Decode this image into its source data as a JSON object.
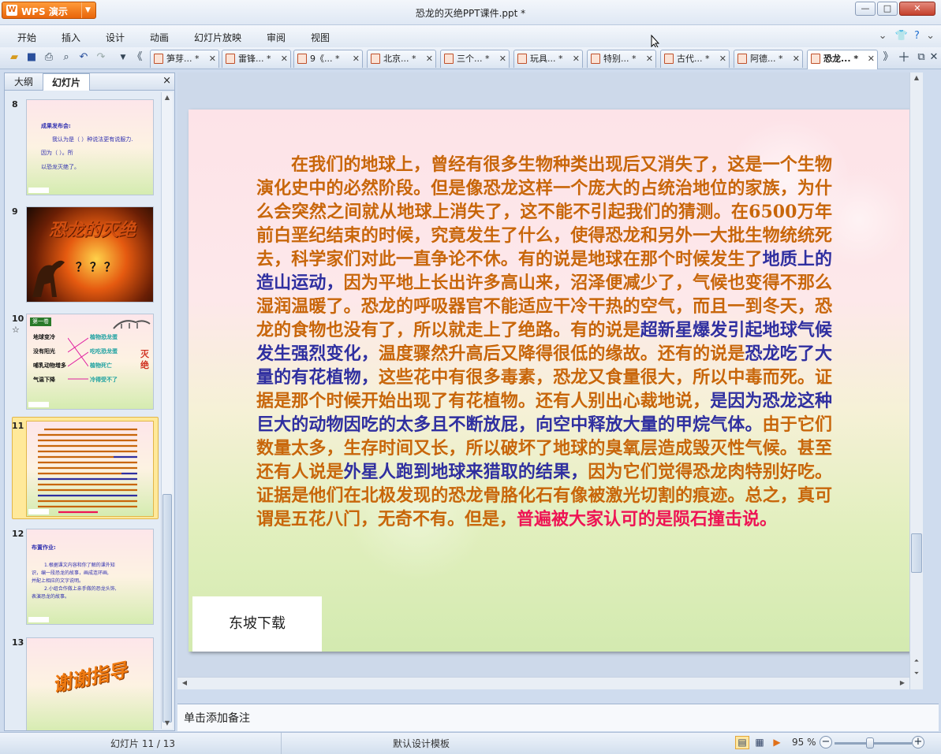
{
  "app": {
    "name": "WPS 演示",
    "doc_title": "恐龙的灭绝PPT课件.ppt *"
  },
  "window_buttons": {
    "minimize": "—",
    "maximize": "□",
    "close": "✕"
  },
  "menu": [
    "开始",
    "插入",
    "设计",
    "动画",
    "幻灯片放映",
    "审阅",
    "视图"
  ],
  "doc_tabs": [
    {
      "label": "笋芽... *"
    },
    {
      "label": "雷锋... *"
    },
    {
      "label": "9《... *"
    },
    {
      "label": "北京... *"
    },
    {
      "label": "三个... *"
    },
    {
      "label": "玩具... *"
    },
    {
      "label": "特别... *"
    },
    {
      "label": "古代... *"
    },
    {
      "label": "阿德... *"
    },
    {
      "label": "恐龙... *"
    }
  ],
  "panel": {
    "tab_outline": "大纲",
    "tab_slides": "幻灯片",
    "close": "×"
  },
  "thumbnails": {
    "s8": {
      "num": "8",
      "lines": [
        "成果发布会:",
        "我认为是（   ）种说法更有说服力.",
        "因为（                             ）。所",
        "以恐龙灭绝了。"
      ]
    },
    "s9": {
      "num": "9",
      "title": "恐龙的灭绝",
      "marks": "？？？"
    },
    "s10": {
      "num": "10",
      "star": "☆",
      "tag": "第一卷",
      "left": [
        "地球变冷",
        "没有阳光",
        "哺乳动物增多",
        "气温下降"
      ],
      "right": [
        "植物恐龙蛋",
        "吃吃恐龙蛋",
        "植物死亡",
        "冷得受不了"
      ],
      "side": "灭绝"
    },
    "s11": {
      "num": "11"
    },
    "s12": {
      "num": "12",
      "lines": [
        "布置作业:",
        "1.根据课文内容和你了解的课外知",
        "识，编一段恐龙的故事，画成连环画,",
        "并配上相应的文字说明。",
        "2.小组合作做上亲手做的恐龙头饰,",
        "表演恐龙的故事。"
      ]
    },
    "s13": {
      "num": "13",
      "title": "谢谢指导"
    }
  },
  "slide": {
    "segments": [
      {
        "t": "在我们的地球上，曾经有很多生物种类出现后又消失了，这是一个生物演化史中的必然阶段。但是像恐龙这样一个庞大的占统治地位的家族，为什么会突然之间就从地球上消失了，这不能不引起我们的猜测。在6500万年前白垩纪结束的时候，究竟发生了什么，使得恐龙和另外一大批生物统统死去，科学家们对此一直争论不休。有的说是地球在那个时候发生了",
        "c": "orange"
      },
      {
        "t": "地质上的造山运动，",
        "c": "blue"
      },
      {
        "t": "因为平地上长出许多高山来，沼泽便减少了，气候也变得不那么湿润温暖了。恐龙的呼吸器官不能适应干冷干热的空气，而且一到冬天，恐龙的食物也没有了，所以就走上了绝路。有的说是",
        "c": "orange"
      },
      {
        "t": "超新星爆发引起地球气候发生强烈变化，",
        "c": "blue"
      },
      {
        "t": "温度骤然升高后又降得很低的缘故。还有的说是",
        "c": "orange"
      },
      {
        "t": "恐龙吃了大量的有花植物，",
        "c": "blue"
      },
      {
        "t": "这些花中有很多毒素，恐龙又食量很大，所以中毒而死。证据是那个时候开始出现了有花植物。还有人别出心裁地说，",
        "c": "orange"
      },
      {
        "t": "是因为恐龙这种巨大的动物因吃的太多且不断放屁，向空中释放大量的甲烷气体。",
        "c": "blue"
      },
      {
        "t": "由于它们数量太多，生存时间又长，所以破坏了地球的臭氧层造成毁灭性气候。甚至还有人说是",
        "c": "orange"
      },
      {
        "t": "外星人跑到地球来猎取的结果，",
        "c": "blue"
      },
      {
        "t": "因为它们觉得恐龙肉特别好吃。证据是他们在北极发现的恐龙骨胳化石有像被激光切割的痕迹。总之，真可谓是五花八门，无奇不有。但是，",
        "c": "orange"
      },
      {
        "t": "普遍被大家认可的是陨石撞击说。",
        "c": "red"
      }
    ],
    "watermark": "东坡下载"
  },
  "notes_placeholder": "单击添加备注",
  "status": {
    "slide_counter": "幻灯片 11 / 13",
    "template": "默认设计模板",
    "zoom": "95 %"
  },
  "colors": {
    "orange": "#c8660a",
    "blue": "#2f2fa0",
    "red": "#ee1454",
    "accent": "#e8650a"
  }
}
